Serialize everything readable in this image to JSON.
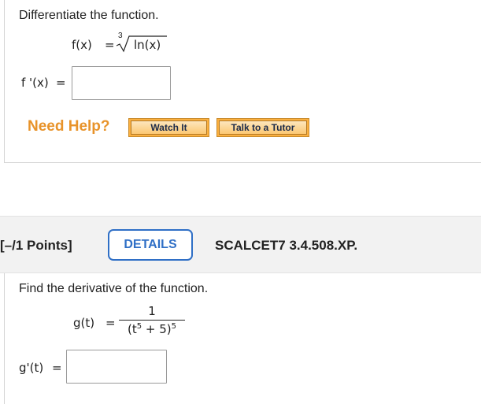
{
  "problem1": {
    "instruction": "Differentiate the function.",
    "function_lhs": "f(x)",
    "equals": "=",
    "root_index": "3",
    "radicand": "ln(x)",
    "answer_label": "f '(x)",
    "answer_value": ""
  },
  "help": {
    "need_help": "Need Help?",
    "watch_it": "Watch It",
    "talk_to_tutor": "Talk to a Tutor"
  },
  "problem2_header": {
    "points": "[–/1 Points]",
    "details_button": "DETAILS",
    "problem_id": "SCALCET7 3.4.508.XP."
  },
  "problem2": {
    "instruction": "Find the derivative of the function.",
    "function_lhs": "g(t)",
    "equals": "=",
    "numerator": "1",
    "den_open": "(t",
    "den_inner_exp": "5",
    "den_rest": " + 5)",
    "den_outer_exp": "5",
    "answer_label": "g'(t)",
    "answer_value": ""
  },
  "colors": {
    "need_help": "#e8932a",
    "button_fill": "#fbb040",
    "details_accent": "#2f6fc6",
    "header_band": "#f2f2f2"
  }
}
